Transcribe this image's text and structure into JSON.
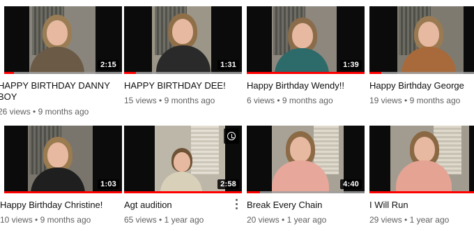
{
  "videos": [
    {
      "title": "HAPPY BIRTHDAY DANNY BOY",
      "views": "26 views",
      "age": "9 months ago",
      "duration": "2:15",
      "progress": 0.08
    },
    {
      "title": "HAPPY BIRTHDAY DEE!",
      "views": "15 views",
      "age": "9 months ago",
      "duration": "1:31",
      "progress": 0.1
    },
    {
      "title": "Happy Birthday Wendy!!",
      "views": "6 views",
      "age": "9 months ago",
      "duration": "1:39",
      "progress": 1.0
    },
    {
      "title": "Happy Birthday George",
      "views": "19 views",
      "age": "9 months ago",
      "duration": "",
      "progress": 0.1
    },
    {
      "title": "Happy Birthday Christine!",
      "views": "10 views",
      "age": "9 months ago",
      "duration": "1:03",
      "progress": 1.0
    },
    {
      "title": "Agt audition",
      "views": "65 views",
      "age": "1 year ago",
      "duration": "2:58",
      "progress": 1.0
    },
    {
      "title": "Break Every Chain",
      "views": "20 views",
      "age": "1 year ago",
      "duration": "4:40",
      "progress": 0.11
    },
    {
      "title": "I Will Run",
      "views": "29 views",
      "age": "1 year ago",
      "duration": "",
      "progress": 1.0
    }
  ],
  "separator": "•",
  "colors": {
    "progress": "#ff0000",
    "meta": "#606060",
    "title": "#0f0f0f"
  },
  "icons": {
    "watch_later": "clock-icon",
    "more": "more-vertical-icon"
  }
}
